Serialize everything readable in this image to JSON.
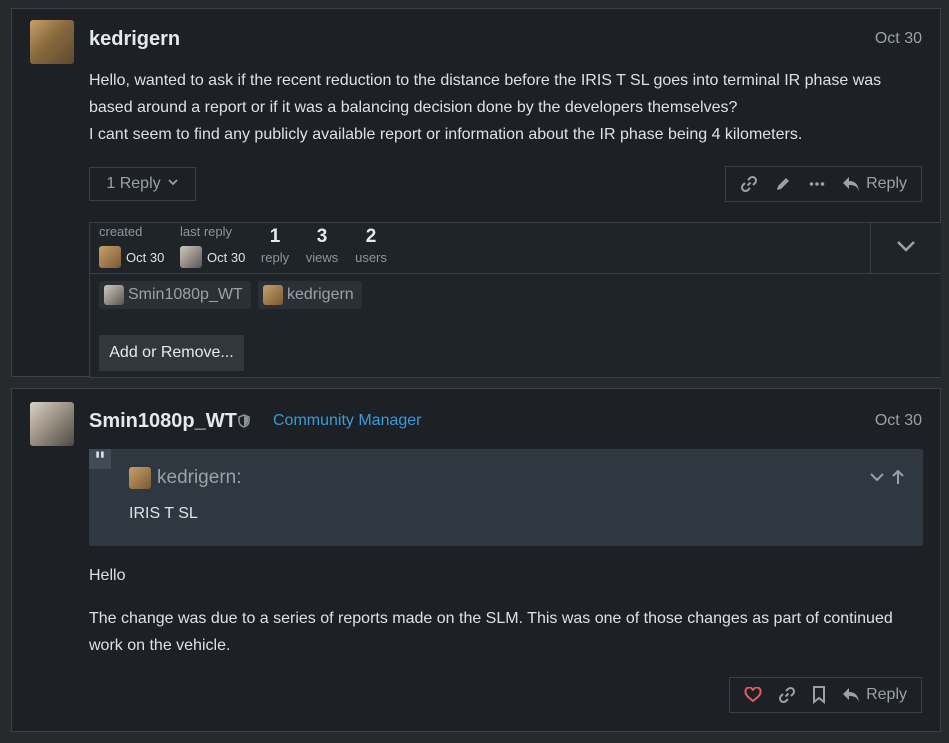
{
  "post1": {
    "username": "kedrigern",
    "date": "Oct 30",
    "paragraphs": [
      "Hello, wanted to ask if the recent reduction to the distance before the IRIS T SL goes into terminal IR phase was based around a report or if it was a balancing decision done by the developers themselves?",
      "I cant seem to find any publicly available report or information about the IR phase being 4 kilometers."
    ],
    "reply_count_label": "1 Reply",
    "actions": {
      "reply_label": "Reply"
    },
    "topic_map": {
      "created_label": "created",
      "created_date": "Oct 30",
      "last_reply_label": "last reply",
      "last_reply_date": "Oct 30",
      "stats": [
        {
          "value": "1",
          "label": "reply"
        },
        {
          "value": "3",
          "label": "views"
        },
        {
          "value": "2",
          "label": "users"
        }
      ],
      "participants": [
        "Smin1080p_WT",
        "kedrigern"
      ],
      "add_remove_label": "Add or Remove..."
    }
  },
  "post2": {
    "username": "Smin1080p_WT",
    "user_title": "Community Manager",
    "date": "Oct 30",
    "quote": {
      "author": "kedrigern:",
      "text": "IRIS T SL"
    },
    "paragraphs": [
      "Hello",
      "The change was due to a series of reports made on the SLM. This was one of those changes as part of continued work on the vehicle."
    ],
    "actions": {
      "reply_label": "Reply"
    }
  },
  "colors": {
    "background": "#262a2d",
    "post_bg": "#1d2125",
    "accent": "#3b9ad9",
    "like_heart": "#e45c5c"
  }
}
